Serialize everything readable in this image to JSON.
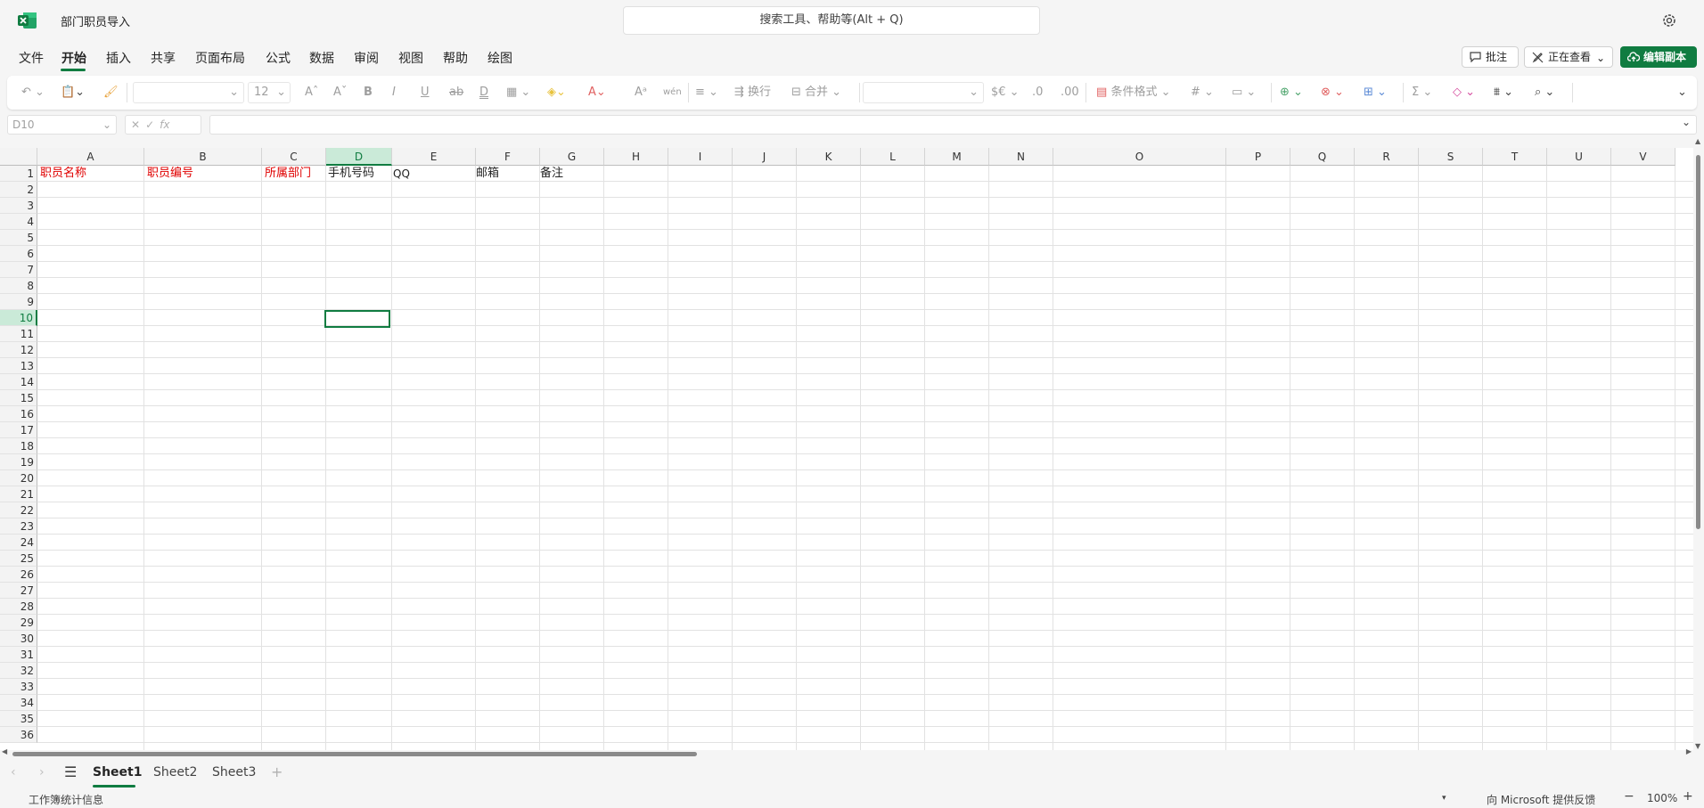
{
  "app": {
    "doc_title": "部门职员导入",
    "search_placeholder": "搜索工具、帮助等(Alt + Q)"
  },
  "menu": [
    "文件",
    "开始",
    "插入",
    "共享",
    "页面布局",
    "公式",
    "数据",
    "审阅",
    "视图",
    "帮助",
    "绘图"
  ],
  "menu_active": "开始",
  "actions": {
    "comment": "批注",
    "viewing": "正在查看",
    "edit_copy": "编辑副本"
  },
  "ribbon": {
    "font_size": "12",
    "wrap": "换行",
    "merge": "合并",
    "conditional_format": "条件格式",
    "number_format": "$€"
  },
  "formula_bar": {
    "name_box": "D10",
    "fx": "fx",
    "formula": ""
  },
  "grid": {
    "columns": [
      "A",
      "B",
      "C",
      "D",
      "E",
      "F",
      "G",
      "H",
      "I",
      "J",
      "K",
      "L",
      "M",
      "N",
      "O",
      "P",
      "Q",
      "R",
      "S",
      "T",
      "U",
      "V"
    ],
    "selected_column": "D",
    "rows": [
      "1",
      "2",
      "3",
      "4",
      "5",
      "6",
      "7",
      "8",
      "9",
      "10",
      "11",
      "12",
      "13",
      "14",
      "15",
      "16",
      "17",
      "18",
      "19",
      "20",
      "21",
      "22",
      "23",
      "24",
      "25",
      "26",
      "27",
      "28",
      "29",
      "30",
      "31",
      "32",
      "33",
      "34",
      "35",
      "36"
    ],
    "selected_row": "10",
    "selected_cell": "D10",
    "row1": {
      "A": "职员名称",
      "B": "职员编号",
      "C": "所属部门",
      "D": "手机号码",
      "E": "QQ",
      "F": "邮箱",
      "G": "备注"
    },
    "required_color": "#e00000"
  },
  "sheets": [
    "Sheet1",
    "Sheet2",
    "Sheet3"
  ],
  "active_sheet": "Sheet1",
  "status": {
    "workbook_stats": "工作簿统计信息",
    "feedback": "向 Microsoft 提供反馈",
    "zoom": "100%"
  },
  "colors": {
    "accent": "#107c41",
    "selection_bg": "#caead8"
  }
}
